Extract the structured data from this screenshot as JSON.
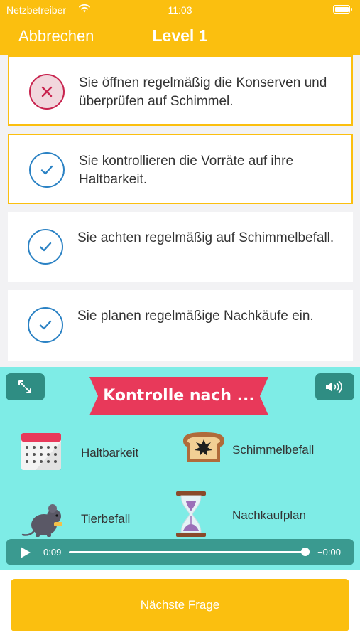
{
  "status_bar": {
    "carrier": "Netzbetreiber",
    "time": "11:03"
  },
  "nav": {
    "cancel_label": "Abbrechen",
    "title": "Level 1"
  },
  "answers": [
    {
      "text": "Sie öffnen regelmäßig die Konserven und überprüfen auf Schimmel.",
      "selected": true,
      "state": "wrong"
    },
    {
      "text": "Sie kontrollieren die Vorräte auf ihre Haltbarkeit.",
      "selected": true,
      "state": "correct"
    },
    {
      "text": "Sie achten regelmäßig auf Schimmelbefall.",
      "selected": false,
      "state": "correct"
    },
    {
      "text": "Sie planen regelmäßige Nachkäufe ein.",
      "selected": false,
      "state": "correct"
    }
  ],
  "media": {
    "banner": "Kontrolle nach ...",
    "items": [
      {
        "icon": "calendar-icon",
        "label": "Haltbarkeit"
      },
      {
        "icon": "moldy-bread-icon",
        "label": "Schimmelbefall"
      },
      {
        "icon": "mouse-icon",
        "label": "Tierbefall"
      },
      {
        "icon": "hourglass-icon",
        "label": "Nachkaufplan"
      }
    ],
    "player": {
      "elapsed": "0:09",
      "remaining": "−0:00",
      "progress": 0.98
    }
  },
  "next_button": "Nächste Frage",
  "colors": {
    "accent": "#fbbf0f",
    "correct": "#2b82c4",
    "wrong": "#c8234e",
    "media_bg": "#7eece6",
    "banner": "#e8395a"
  }
}
